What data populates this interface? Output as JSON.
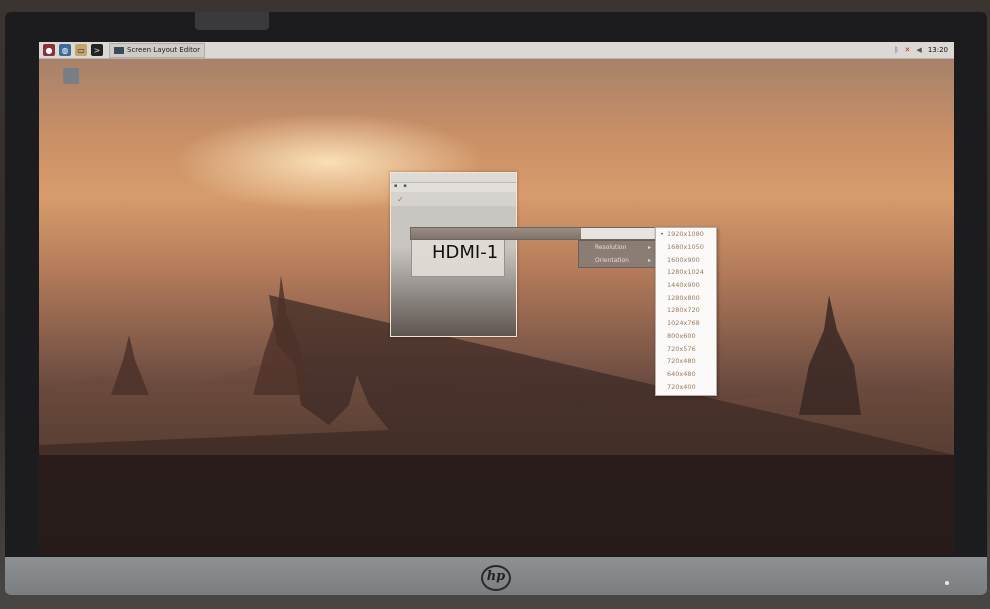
{
  "taskbar": {
    "task_title": "Screen Layout Editor",
    "clock": "13:20",
    "icons": [
      "raspberry-menu-icon",
      "browser-globe-icon",
      "file-manager-icon",
      "terminal-icon"
    ],
    "tray_icons": [
      "bluetooth-icon",
      "network-disconnected-icon",
      "volume-icon"
    ]
  },
  "window": {
    "output_name": "HDMI-1",
    "menu_items": [
      "Resolution",
      "Orientation"
    ]
  },
  "resolutions": [
    "1920x1080",
    "1680x1050",
    "1600x900",
    "1280x1024",
    "1440x900",
    "1280x800",
    "1280x720",
    "1024x768",
    "800x600",
    "720x576",
    "720x480",
    "640x480",
    "720x400"
  ],
  "colors": {
    "taskbar": "#dcd9d5",
    "menu_bg": "#fbfaf8",
    "menu_text": "#9c7c60"
  }
}
